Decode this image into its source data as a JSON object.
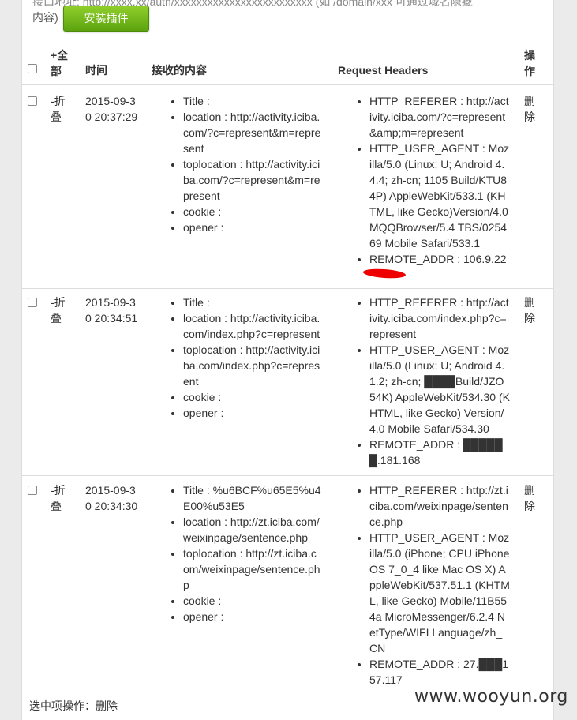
{
  "hint": {
    "line1": "接口地址: http://xxxx.xx/auth/xxxxxxxxxxxxxxxxxxxxxxxxx (如 /domain/xxx 可通过域名隐藏",
    "line2": "内容)",
    "install_button": "安装插件"
  },
  "table": {
    "headers": {
      "expand_all": "+全部",
      "time": "时间",
      "content": "接收的内容",
      "request_headers": "Request Headers",
      "actions": "操作"
    },
    "rows": [
      {
        "fold": "-折叠",
        "time": "2015-09-30 20:37:29",
        "content": [
          "Title :",
          "location : http://activity.iciba.com/?c=represent&m=represent",
          "toplocation : http://activity.iciba.com/?c=represent&m=represent",
          "cookie :",
          "opener :"
        ],
        "headers": [
          "HTTP_REFERER : http://activity.iciba.com/?c=represent&amp;m=represent",
          "HTTP_USER_AGENT : Mozilla/5.0 (Linux; U; Android 4.4.4; zh-cn; 1105 Build/KTU84P) AppleWebKit/533.1 (KHTML, like Gecko)Version/4.0 MQQBrowser/5.4 TBS/025469 Mobile Safari/533.1",
          "REMOTE_ADDR : 106.9.22"
        ],
        "delete": "删除"
      },
      {
        "fold": "-折叠",
        "time": "2015-09-30 20:34:51",
        "content": [
          "Title :",
          "location : http://activity.iciba.com/index.php?c=represent",
          "toplocation : http://activity.iciba.com/index.php?c=represent",
          "cookie :",
          "opener :"
        ],
        "headers": [
          "HTTP_REFERER : http://activity.iciba.com/index.php?c=represent",
          "HTTP_USER_AGENT : Mozilla/5.0 (Linux; U; Android 4.1.2; zh-cn; ████Build/JZO54K) AppleWebKit/534.30 (KHTML, like Gecko) Version/4.0 Mobile Safari/534.30",
          "REMOTE_ADDR : ██████.181.168"
        ],
        "delete": "删除"
      },
      {
        "fold": "-折叠",
        "time": "2015-09-30 20:34:30",
        "content": [
          "Title : %u6BCF%u65E5%u4E00%u53E5",
          "location : http://zt.iciba.com/weixinpage/sentence.php",
          "toplocation : http://zt.iciba.com/weixinpage/sentence.php",
          "cookie :",
          "opener :"
        ],
        "headers": [
          "HTTP_REFERER : http://zt.iciba.com/weixinpage/sentence.php",
          "HTTP_USER_AGENT : Mozilla/5.0 (iPhone; CPU iPhone OS 7_0_4 like Mac OS X) AppleWebKit/537.51.1 (KHTML, like Gecko) Mobile/11B554a MicroMessenger/6.2.4 NetType/WIFI Language/zh_CN",
          "REMOTE_ADDR : 27.███157.117"
        ],
        "delete": "删除"
      }
    ]
  },
  "footer": {
    "label": "选中项操作：",
    "delete_link": "删除"
  },
  "watermark": "www.wooyun.org",
  "colors": {
    "button_green": "#6fb91a",
    "redaction": "#ee0000",
    "border": "#dddddd"
  }
}
